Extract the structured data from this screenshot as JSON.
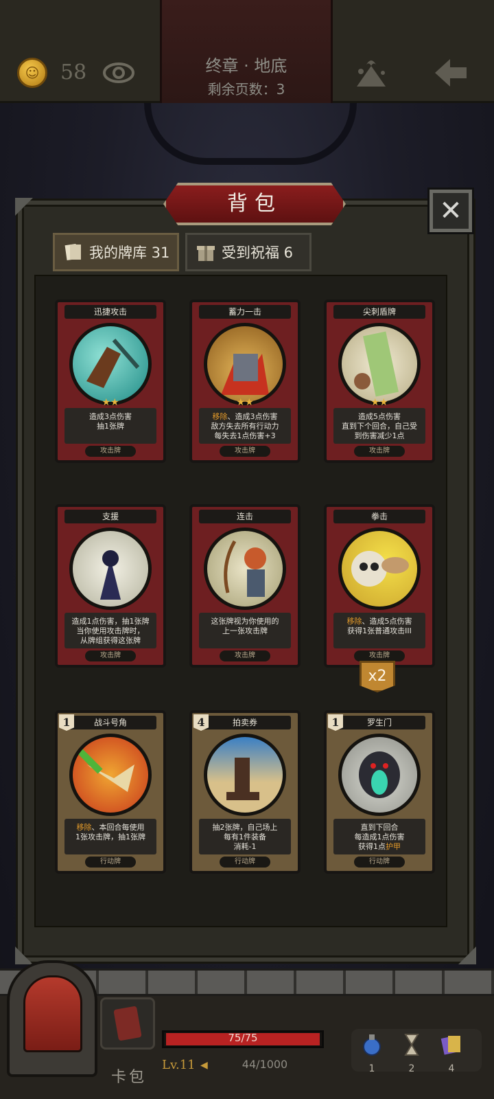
{
  "topbar": {
    "coin_icon_glyph": "☺",
    "gold": "58",
    "title": "终章 · 地底",
    "pages_remaining": "剩余页数：3"
  },
  "panel": {
    "title": "背包",
    "close_glyph": "✕",
    "tabs": [
      {
        "label": "我的牌库 31",
        "active": true
      },
      {
        "label": "受到祝福 6",
        "active": false
      }
    ]
  },
  "cards": [
    {
      "name": "迅捷攻击",
      "stars": "★★",
      "desc": "造成3点伤害\n抽1张牌",
      "kind": "攻击牌",
      "type": "attack"
    },
    {
      "name": "蓄力一击",
      "stars": "★★",
      "desc_accent": "移除",
      "desc": "、造成3点伤害\n敌方失去所有行动力\n每失去1点伤害+3",
      "kind": "攻击牌",
      "type": "attack"
    },
    {
      "name": "尖刺盾牌",
      "stars": "★★",
      "desc": "造成5点伤害\n直到下个回合，自己受\n到伤害减少1点",
      "kind": "攻击牌",
      "type": "attack"
    },
    {
      "name": "支援",
      "stars": "",
      "desc": "造成1点伤害，抽1张牌\n当你使用攻击牌时，\n从牌组获得这张牌",
      "kind": "攻击牌",
      "type": "attack"
    },
    {
      "name": "连击",
      "stars": "",
      "desc": "这张牌视为你使用的\n上一张攻击牌",
      "kind": "攻击牌",
      "type": "attack"
    },
    {
      "name": "拳击",
      "stars": "",
      "desc_accent": "移除",
      "desc": "、造成5点伤害\n获得1张普通攻击III",
      "kind": "攻击牌",
      "type": "attack"
    },
    {
      "name": "战斗号角",
      "cost": "1",
      "stars": "",
      "desc_accent": "移除",
      "desc": "、本回合每使用\n1张攻击牌，抽1张牌",
      "kind": "行动牌",
      "type": "action"
    },
    {
      "name": "拍卖券",
      "cost": "4",
      "stars": "",
      "desc": "抽2张牌，自己场上\n每有1件装备\n消耗-1",
      "kind": "行动牌",
      "type": "action"
    },
    {
      "name": "罗生门",
      "cost": "1",
      "stars": "",
      "desc": "直到下回合\n每造成1点伤害\n获得1点",
      "desc_tail_accent": "护甲",
      "kind": "行动牌",
      "type": "action"
    }
  ],
  "multiplier": "x2",
  "hud": {
    "deck_label": "卡包",
    "hp_text": "75/75",
    "hp_fraction": 1.0,
    "level": "Lv.11",
    "level_arrow": "◀",
    "xp_text": "44/1000",
    "inventory": [
      {
        "icon": "potion-icon",
        "count": "1"
      },
      {
        "icon": "hourglass-icon",
        "count": "2"
      },
      {
        "icon": "cards-icon",
        "count": "4"
      }
    ]
  },
  "colors": {
    "accent": "#e39a2a",
    "hp": "#b82222",
    "attack_frame": "#6e1f21",
    "action_frame": "#6d5a3b"
  }
}
